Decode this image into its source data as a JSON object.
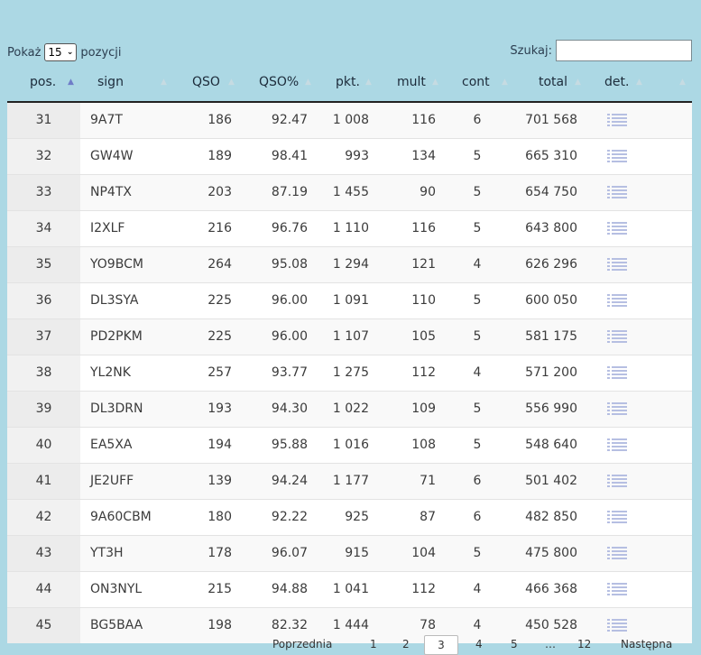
{
  "controls": {
    "show_label": "Pokaż",
    "page_size": "15",
    "entries_label": "pozycji",
    "search_label": "Szukaj:",
    "search_value": ""
  },
  "columns": [
    "pos.",
    "sign",
    "QSO",
    "QSO%",
    "pkt.",
    "mult",
    "cont",
    "total",
    "det."
  ],
  "rows": [
    {
      "pos": "31",
      "sign": "9A7T",
      "qso": "186",
      "qso_pct": "92.47",
      "pkt": "1 008",
      "mult": "116",
      "cont": "6",
      "total": "701 568"
    },
    {
      "pos": "32",
      "sign": "GW4W",
      "qso": "189",
      "qso_pct": "98.41",
      "pkt": "993",
      "mult": "134",
      "cont": "5",
      "total": "665 310"
    },
    {
      "pos": "33",
      "sign": "NP4TX",
      "qso": "203",
      "qso_pct": "87.19",
      "pkt": "1 455",
      "mult": "90",
      "cont": "5",
      "total": "654 750"
    },
    {
      "pos": "34",
      "sign": "I2XLF",
      "qso": "216",
      "qso_pct": "96.76",
      "pkt": "1 110",
      "mult": "116",
      "cont": "5",
      "total": "643 800"
    },
    {
      "pos": "35",
      "sign": "YO9BCM",
      "qso": "264",
      "qso_pct": "95.08",
      "pkt": "1 294",
      "mult": "121",
      "cont": "4",
      "total": "626 296"
    },
    {
      "pos": "36",
      "sign": "DL3SYA",
      "qso": "225",
      "qso_pct": "96.00",
      "pkt": "1 091",
      "mult": "110",
      "cont": "5",
      "total": "600 050"
    },
    {
      "pos": "37",
      "sign": "PD2PKM",
      "qso": "225",
      "qso_pct": "96.00",
      "pkt": "1 107",
      "mult": "105",
      "cont": "5",
      "total": "581 175"
    },
    {
      "pos": "38",
      "sign": "YL2NK",
      "qso": "257",
      "qso_pct": "93.77",
      "pkt": "1 275",
      "mult": "112",
      "cont": "4",
      "total": "571 200"
    },
    {
      "pos": "39",
      "sign": "DL3DRN",
      "qso": "193",
      "qso_pct": "94.30",
      "pkt": "1 022",
      "mult": "109",
      "cont": "5",
      "total": "556 990"
    },
    {
      "pos": "40",
      "sign": "EA5XA",
      "qso": "194",
      "qso_pct": "95.88",
      "pkt": "1 016",
      "mult": "108",
      "cont": "5",
      "total": "548 640"
    },
    {
      "pos": "41",
      "sign": "JE2UFF",
      "qso": "139",
      "qso_pct": "94.24",
      "pkt": "1 177",
      "mult": "71",
      "cont": "6",
      "total": "501 402"
    },
    {
      "pos": "42",
      "sign": "9A60CBM",
      "qso": "180",
      "qso_pct": "92.22",
      "pkt": "925",
      "mult": "87",
      "cont": "6",
      "total": "482 850"
    },
    {
      "pos": "43",
      "sign": "YT3H",
      "qso": "178",
      "qso_pct": "96.07",
      "pkt": "915",
      "mult": "104",
      "cont": "5",
      "total": "475 800"
    },
    {
      "pos": "44",
      "sign": "ON3NYL",
      "qso": "215",
      "qso_pct": "94.88",
      "pkt": "1 041",
      "mult": "112",
      "cont": "4",
      "total": "466 368"
    },
    {
      "pos": "45",
      "sign": "BG5BAA",
      "qso": "198",
      "qso_pct": "82.32",
      "pkt": "1 444",
      "mult": "78",
      "cont": "4",
      "total": "450 528"
    }
  ],
  "pagination": {
    "prev": "Poprzednia",
    "pages": [
      "1",
      "2",
      "3",
      "4",
      "5",
      "…",
      "12"
    ],
    "current": "3",
    "next": "Następna"
  },
  "colors": {
    "background": "#acd8e4",
    "sort_active": "#6f7dc8",
    "detail_icon": "#b6bfe2"
  }
}
